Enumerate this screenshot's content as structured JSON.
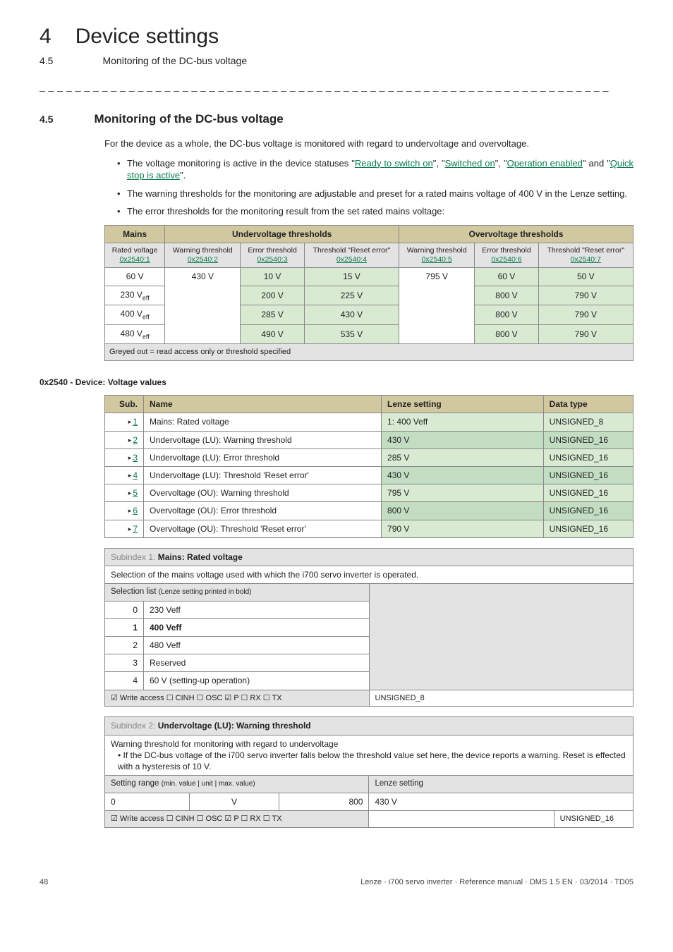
{
  "header": {
    "chapter_num": "4",
    "chapter_title": "Device settings",
    "section_num_top": "4.5",
    "section_title_top": "Monitoring of the DC-bus voltage"
  },
  "dashes": "_ _ _ _ _ _ _ _ _ _ _ _ _ _ _ _ _ _ _ _ _ _ _ _ _ _ _ _ _ _ _ _ _ _ _ _ _ _ _ _ _ _ _ _ _ _ _ _ _ _ _ _ _ _ _ _ _ _ _ _ _ _ _ _",
  "section": {
    "num": "4.5",
    "title": "Monitoring of the DC-bus voltage",
    "para1_a": "For the device as a whole, the DC-bus voltage is monitored with regard to undervoltage and overvoltage.",
    "bullet1_a": "The voltage monitoring is active in the device statuses \"",
    "bullet1_link1": "Ready to switch on",
    "bullet1_b": "\", \"",
    "bullet1_link2": "Switched on",
    "bullet1_c": "\", \"",
    "bullet1_link3": "Operation enabled",
    "bullet1_d": "\" and \"",
    "bullet1_link4": "Quick stop is active",
    "bullet1_e": "\".",
    "bullet2": "The warning thresholds for the monitoring are adjustable and preset for a rated mains voltage of 400 V in the Lenze setting.",
    "bullet3": "The error thresholds for the monitoring result from the set rated mains voltage:"
  },
  "thresh_table": {
    "head_mains": "Mains",
    "head_under": "Undervoltage thresholds",
    "head_over": "Overvoltage thresholds",
    "sub": {
      "c1a": "Rated voltage",
      "c1b": "0x2540:1",
      "c2a": "Warning threshold",
      "c2b": "0x2540:2",
      "c3a": "Error threshold",
      "c3b": "0x2540:3",
      "c4a": "Threshold \"Reset error\"",
      "c4b": "0x2540:4",
      "c5a": "Warning threshold",
      "c5b": "0x2540:5",
      "c6a": "Error threshold",
      "c6b": "0x2540:6",
      "c7a": "Threshold \"Reset error\"",
      "c7b": "0x2540:7"
    },
    "rows": [
      {
        "c1": "60 V",
        "c2": "430 V",
        "c3": "10 V",
        "c4": "15 V",
        "c5": "795 V",
        "c6": "60 V",
        "c7": "50 V"
      },
      {
        "c1": "230 V",
        "c3": "200 V",
        "c4": "225 V",
        "c6": "800 V",
        "c7": "790 V"
      },
      {
        "c1": "400 V",
        "c3": "285 V",
        "c4": "430 V",
        "c6": "800 V",
        "c7": "790 V"
      },
      {
        "c1": "480 V",
        "c3": "490 V",
        "c4": "535 V",
        "c6": "800 V",
        "c7": "790 V"
      }
    ],
    "note": "Greyed out = read access only or threshold specified"
  },
  "code_heading": "0x2540 - Device: Voltage values",
  "params_table": {
    "head": {
      "sub": "Sub.",
      "name": "Name",
      "lenze": "Lenze setting",
      "dtype": "Data type"
    },
    "rows": [
      {
        "sub": "1",
        "name": "Mains: Rated voltage",
        "lenze": "1: 400 Veff",
        "dtype": "UNSIGNED_8"
      },
      {
        "sub": "2",
        "name": "Undervoltage (LU): Warning threshold",
        "lenze": "430 V",
        "dtype": "UNSIGNED_16"
      },
      {
        "sub": "3",
        "name": "Undervoltage (LU): Error threshold",
        "lenze": "285 V",
        "dtype": "UNSIGNED_16"
      },
      {
        "sub": "4",
        "name": "Undervoltage (LU): Threshold 'Reset error'",
        "lenze": "430 V",
        "dtype": "UNSIGNED_16"
      },
      {
        "sub": "5",
        "name": "Overvoltage (OU): Warning threshold",
        "lenze": "795 V",
        "dtype": "UNSIGNED_16"
      },
      {
        "sub": "6",
        "name": "Overvoltage (OU): Error threshold",
        "lenze": "800 V",
        "dtype": "UNSIGNED_16"
      },
      {
        "sub": "7",
        "name": "Overvoltage (OU): Threshold 'Reset error'",
        "lenze": "790 V",
        "dtype": "UNSIGNED_16"
      }
    ]
  },
  "sub1": {
    "title_pre": "Subindex 1: ",
    "title_b": "Mains: Rated voltage",
    "desc": "Selection of the mains voltage used with which the i700 servo inverter is operated.",
    "sel_head_a": "Selection list ",
    "sel_head_b": "(Lenze setting printed in bold)",
    "rows": [
      {
        "idx": "0",
        "val": "230 Veff"
      },
      {
        "idx": "1",
        "val": "400 Veff"
      },
      {
        "idx": "2",
        "val": "480 Veff"
      },
      {
        "idx": "3",
        "val": "Reserved"
      },
      {
        "idx": "4",
        "val": "60 V (setting-up operation)"
      }
    ],
    "footer_a": "☑ Write access  ☐ CINH  ☐ OSC  ☑ P  ☐ RX  ☐ TX",
    "footer_b": "UNSIGNED_8"
  },
  "sub2": {
    "title_pre": "Subindex 2: ",
    "title_b": "Undervoltage (LU): Warning threshold",
    "desc_a": "Warning threshold for monitoring with regard to undervoltage",
    "desc_b": "• If the DC-bus voltage of the i700 servo inverter falls below the threshold value set here, the device reports a warning. Reset is effected with a hysteresis of 10 V.",
    "range_head_a": "Setting range ",
    "range_head_b": "(min. value | unit | max. value)",
    "range_head_c": "Lenze setting",
    "min": "0",
    "unit": "V",
    "max": "800",
    "lenze": "430 V",
    "footer_a": "☑ Write access  ☐ CINH  ☐ OSC  ☑ P  ☐ RX  ☐ TX",
    "footer_b": "UNSIGNED_16"
  },
  "footer": {
    "page": "48",
    "meta": "Lenze · i700 servo inverter · Reference manual · DMS 1.5 EN · 03/2014 · TD05"
  }
}
